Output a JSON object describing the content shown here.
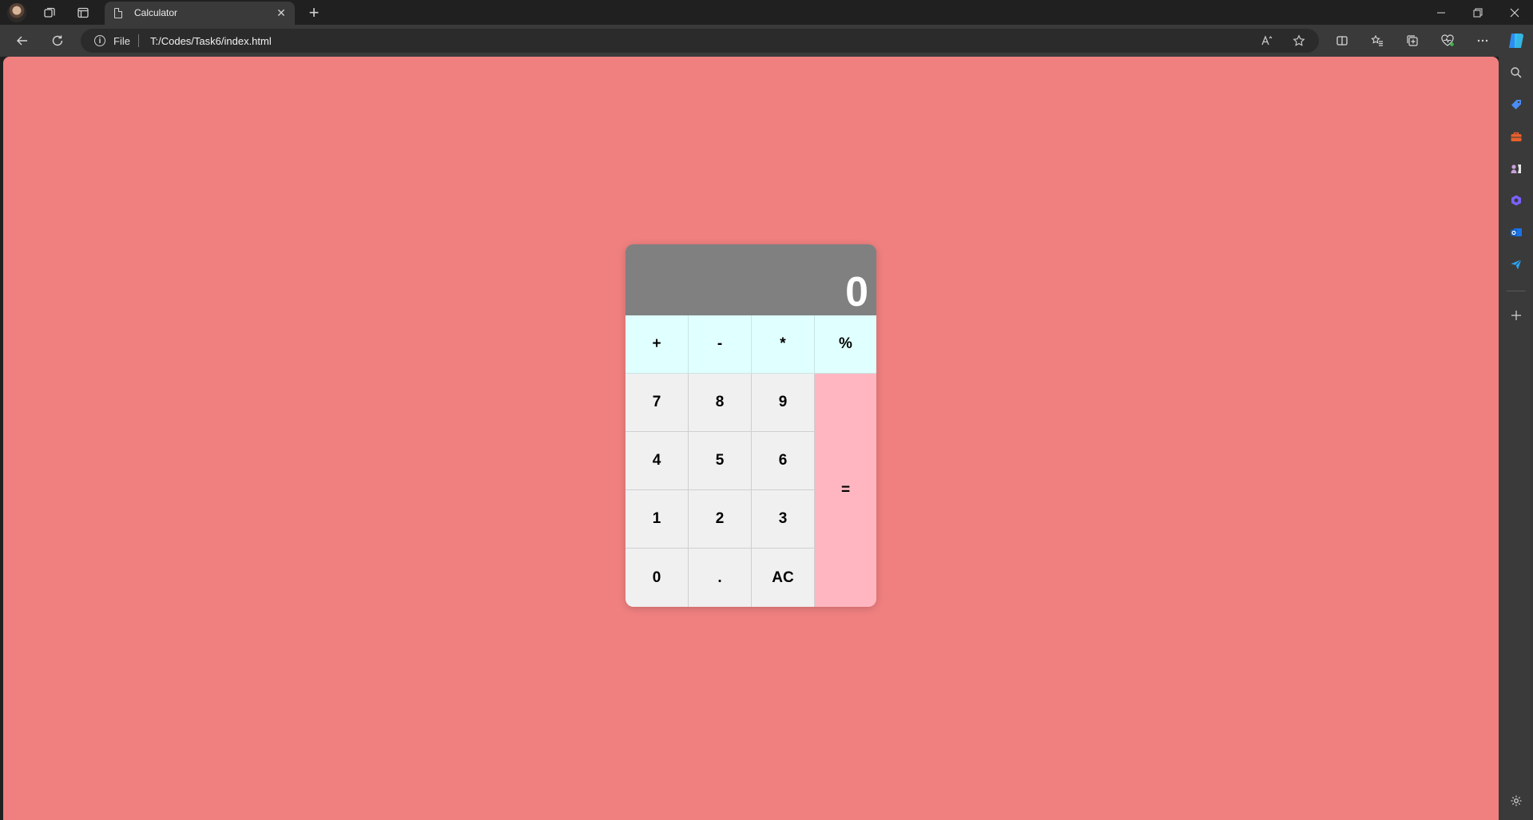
{
  "browser": {
    "tab": {
      "title": "Calculator",
      "close": "✕"
    },
    "new_tab": "+",
    "address": {
      "scheme_label": "File",
      "url": "T:/Codes/Task6/index.html"
    },
    "window_controls": {
      "minimize": "—",
      "restore": "❐",
      "close": "✕"
    }
  },
  "calculator": {
    "display": "0",
    "operators": [
      "+",
      "-",
      "*",
      "%"
    ],
    "rows": [
      [
        "7",
        "8",
        "9"
      ],
      [
        "4",
        "5",
        "6"
      ],
      [
        "1",
        "2",
        "3"
      ],
      [
        "0",
        ".",
        "AC"
      ]
    ],
    "equals": "="
  },
  "colors": {
    "page_background": "#f08080",
    "display_background": "#808080",
    "operator_background": "#e0ffff",
    "number_background": "#f0f0f0",
    "equals_background": "#ffb6c1"
  }
}
